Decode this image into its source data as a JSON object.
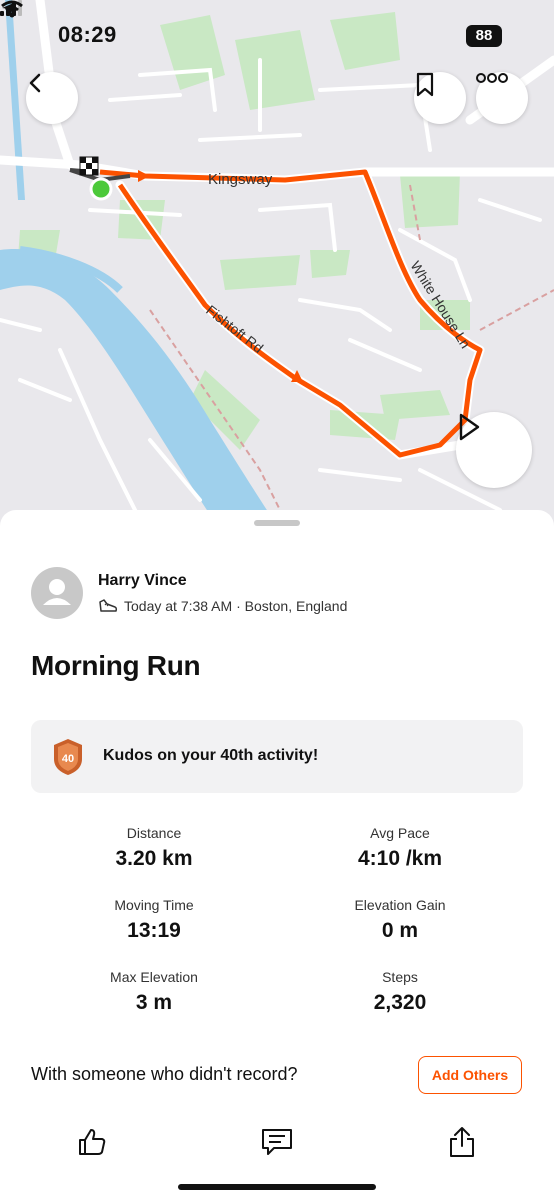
{
  "status_bar": {
    "time": "08:29",
    "battery": "88"
  },
  "map": {
    "street_labels": [
      "Kingsway",
      "White House Ln",
      "Fishtoft Rd"
    ],
    "route_color": "#fc5200",
    "start_marker_color": "#4cc93a"
  },
  "map_controls": {
    "back_icon": "chevron-left-icon",
    "bookmark_icon": "bookmark-icon",
    "more_icon": "more-icon",
    "play_icon": "play-icon"
  },
  "athlete": {
    "name": "Harry Vince",
    "meta": "Today at 7:38 AM · Boston, England"
  },
  "activity": {
    "title": "Morning Run"
  },
  "kudos": {
    "text": "Kudos on your 40th activity!",
    "badge_number": "40"
  },
  "stats": [
    {
      "label": "Distance",
      "value": "3.20 km"
    },
    {
      "label": "Avg Pace",
      "value": "4:10 /km"
    },
    {
      "label": "Moving Time",
      "value": "13:19"
    },
    {
      "label": "Elevation Gain",
      "value": "0 m"
    },
    {
      "label": "Max Elevation",
      "value": "3 m"
    },
    {
      "label": "Steps",
      "value": "2,320"
    }
  ],
  "with_others": {
    "text": "With someone who didn't record?",
    "button": "Add Others"
  },
  "actions": {
    "kudos_icon": "thumbs-up-icon",
    "comment_icon": "comment-icon",
    "share_icon": "share-icon"
  },
  "colors": {
    "accent": "#fc5200",
    "kudos_bg": "#f2f2f3"
  }
}
